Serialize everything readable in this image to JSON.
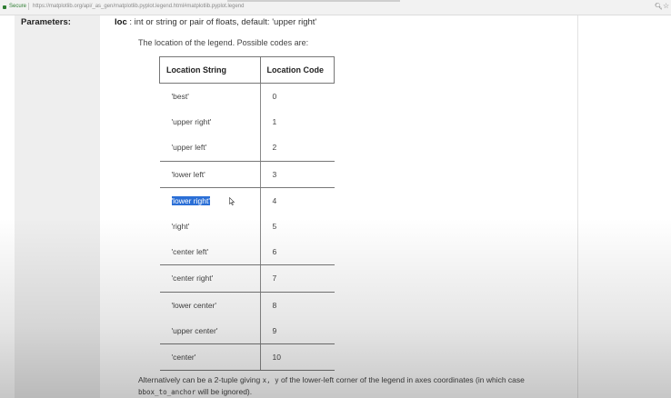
{
  "browser": {
    "secure_label": "Secure",
    "url": "https://matplotlib.org/api/_as_gen/matplotlib.pyplot.legend.html#matplotlib.pyplot.legend"
  },
  "doc": {
    "parameters_label": "Parameters:",
    "loc_name": "loc",
    "loc_signature": " : int or string or pair of floats, default: 'upper right'",
    "description": "The location of the legend. Possible codes are:",
    "table": {
      "headers": [
        "Location String",
        "Location Code"
      ],
      "rows": [
        {
          "string": "'best'",
          "code": "0"
        },
        {
          "string": "'upper right'",
          "code": "1"
        },
        {
          "string": "'upper left'",
          "code": "2"
        },
        {
          "string": "'lower left'",
          "code": "3"
        },
        {
          "string": "'lower right'",
          "code": "4"
        },
        {
          "string": "'right'",
          "code": "5"
        },
        {
          "string": "'center left'",
          "code": "6"
        },
        {
          "string": "'center right'",
          "code": "7"
        },
        {
          "string": "'lower center'",
          "code": "8"
        },
        {
          "string": "'upper center'",
          "code": "9"
        },
        {
          "string": "'center'",
          "code": "10"
        }
      ]
    },
    "footer_part1": "Alternatively can be a 2-tuple giving ",
    "footer_code1": "x, y",
    "footer_part2": " of the lower-left corner of the legend in axes coordinates (in which case ",
    "footer_code2": "bbox_to_anchor",
    "footer_part3": " will be ignored)."
  }
}
